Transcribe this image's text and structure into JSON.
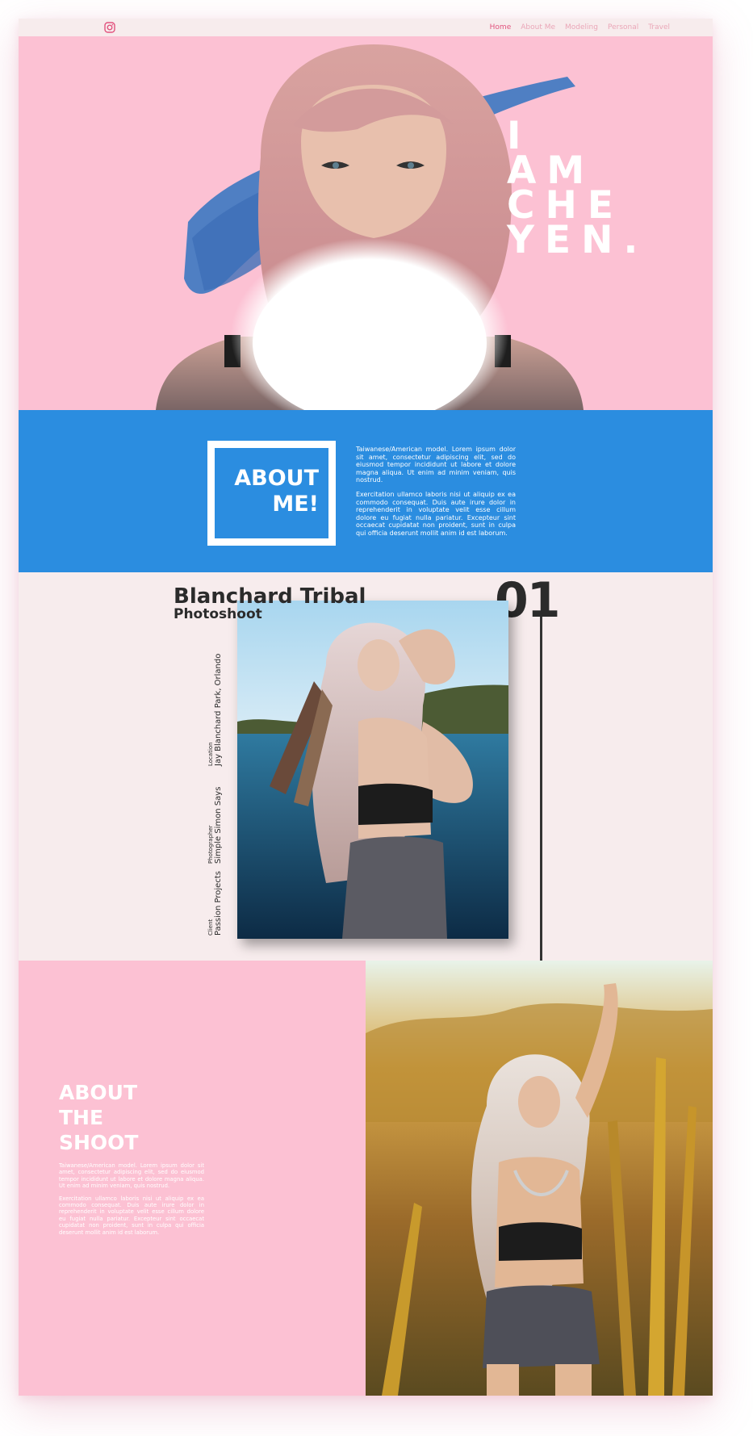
{
  "nav": {
    "items": [
      {
        "label": "Home",
        "active": true
      },
      {
        "label": "About Me",
        "active": false
      },
      {
        "label": "Modeling",
        "active": false
      },
      {
        "label": "Personal",
        "active": false
      },
      {
        "label": "Travel",
        "active": false
      }
    ],
    "social_icon": "instagram-icon"
  },
  "hero": {
    "title": "I\nAM\nCHE\nYEN."
  },
  "about": {
    "heading": "ABOUT\nME!",
    "paragraphs": [
      "Taiwanese/American model. Lorem ipsum dolor sit amet, consectetur adipiscing elit, sed do eiusmod tempor incididunt ut labore et dolore magna aliqua. Ut enim ad minim veniam, quis nostrud.",
      "Exercitation ullamco laboris nisi ut aliquip ex ea commodo consequat. Duis aute irure dolor in reprehenderit in voluptate velit esse cillum dolore eu fugiat nulla pariatur. Excepteur sint occaecat cupidatat non proident, sunt in culpa qui officia deserunt mollit anim id est laborum."
    ]
  },
  "project": {
    "title": "Blanchard Tribal",
    "subtitle": "Photoshoot",
    "number": "01",
    "meta": [
      {
        "key": "Location",
        "value": "Jay Blanchard Park, Orlando"
      },
      {
        "key": "Photographer",
        "value": "Simple Simon Says"
      },
      {
        "key": "Client",
        "value": "Passion Projects"
      }
    ]
  },
  "shoot": {
    "heading": "ABOUT\nTHE\nSHOOT",
    "paragraphs": [
      "Taiwanese/American model. Lorem ipsum dolor sit amet, consectetur adipiscing elit, sed do eiusmod tempor incididunt ut labore et dolore magna aliqua. Ut enim ad minim veniam, quis nostrud.",
      "Exercitation ullamco laboris nisi ut aliquip ex ea commodo consequat. Duis aute irure dolor in reprehenderit in voluptate velit esse cillum dolore eu fugiat nulla pariatur. Excepteur sint occaecat cupidatat non proident, sunt in culpa qui officia deserunt mollit anim id est laborum."
    ]
  },
  "colors": {
    "pink": "#fcc1d3",
    "blue": "#2b8de0",
    "cream": "#f7eced",
    "nav_active": "#e2537e",
    "nav_inactive": "#eaa7b8",
    "dark_text": "#2b2b2b"
  }
}
